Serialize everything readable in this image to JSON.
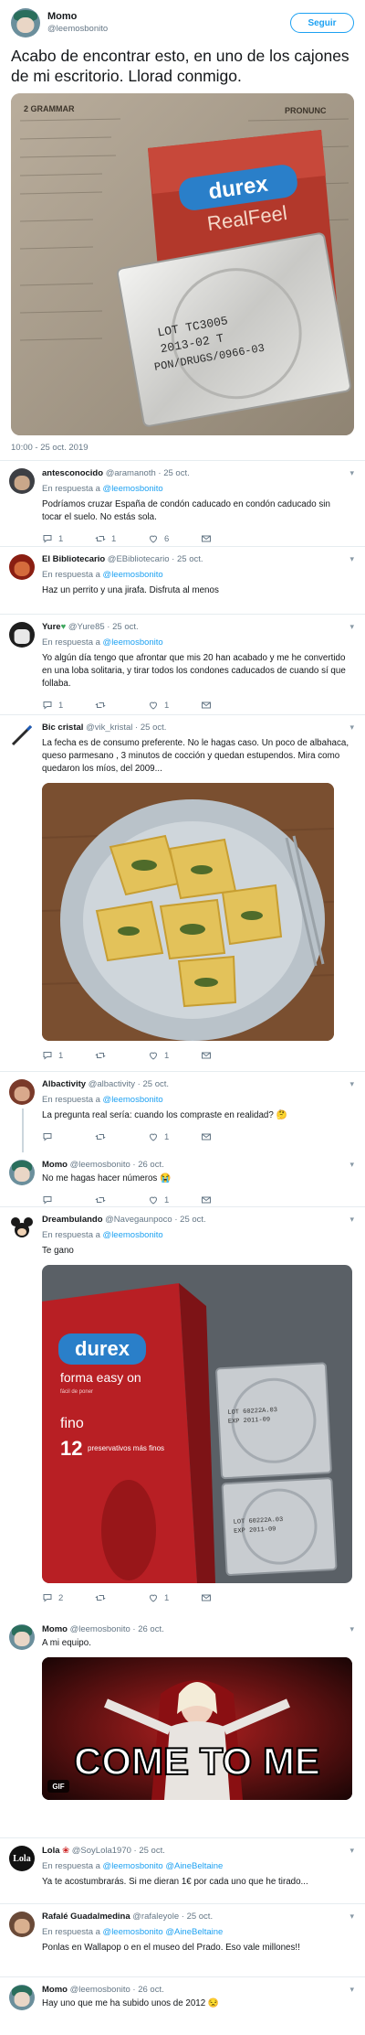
{
  "main_tweet": {
    "display_name": "Momo",
    "handle": "@leemosbonito",
    "follow_label": "Seguir",
    "text": "Acabo de encontrar esto, en uno de los cajones de mi escritorio. Llorad conmigo.",
    "timestamp": "10:00 - 25 oct. 2019",
    "photo_text": {
      "grammar": "2 GRAMMAR",
      "brand": "durex",
      "product": "RealFeel",
      "lot": "LOT TC3005",
      "expiry": "2013-02 T",
      "code": "PON/DRUGS/0966-03",
      "pronunc": "PRONUNC"
    }
  },
  "reply_prefix": "En respuesta a",
  "replies": [
    {
      "name": "antesconocido",
      "handle": "@aramanoth",
      "date": "25 oct.",
      "reply_to": "@leemosbonito",
      "text": "Podríamos cruzar España de condón caducado en condón caducado sin tocar el suelo. No estás sola.",
      "replies": "1",
      "retweets": "1",
      "likes": "6"
    },
    {
      "name": "El Bibliotecario",
      "handle": "@EBibliotecario",
      "date": "25 oct.",
      "reply_to": "@leemosbonito",
      "text": "Haz un perrito y una jirafa. Disfruta al menos",
      "replies": "",
      "retweets": "",
      "likes": ""
    },
    {
      "name": "Yure",
      "handle": "@Yure85",
      "date": "25 oct.",
      "reply_to": "@leemosbonito",
      "text": "Yo algún día tengo que afrontar que mis 20 han acabado y me he convertido en una loba solitaria, y tirar todos los condones caducados de cuando sí que follaba.",
      "replies": "1",
      "retweets": "",
      "likes": "1"
    },
    {
      "name": "Bic cristal",
      "handle": "@vik_kristal",
      "date": "25 oct.",
      "text": "La fecha es de consumo preferente. No le hagas caso. Un poco de albahaca, queso parmesano , 3 minutos de cocción y quedan estupendos. Mira como quedaron los míos, del 2009...",
      "replies": "1",
      "retweets": "",
      "likes": "1"
    },
    {
      "name": "Albactivity",
      "handle": "@albactivity",
      "date": "25 oct.",
      "reply_to": "@leemosbonito",
      "text": "La pregunta real sería: cuando los compraste en realidad? 🤔",
      "replies": "",
      "retweets": "",
      "likes": "1"
    },
    {
      "name": "Momo",
      "handle": "@leemosbonito",
      "date": "26 oct.",
      "text": "No me hagas hacer números 😭",
      "replies": "",
      "retweets": "",
      "likes": "1"
    },
    {
      "name": "Dreambulando",
      "handle": "@Navegaunpoco",
      "date": "25 oct.",
      "reply_to": "@leemosbonito",
      "text": "Te gano",
      "replies": "2",
      "retweets": "",
      "likes": "1",
      "photo_text": {
        "brand": "durex",
        "product": "forma easy on",
        "sub": "fácil de poner",
        "fino": "fino",
        "count": "12",
        "count_label": "preservativos más finos",
        "lot1": "LOT 60222A.03",
        "exp1": "EXP 2011-09",
        "lot2": "LOT 60222A.03",
        "exp2": "EXP 2011-09"
      }
    },
    {
      "name": "Momo",
      "handle": "@leemosbonito",
      "date": "26 oct.",
      "text": "A mi equipo.",
      "replies": "",
      "retweets": "",
      "likes": "1",
      "gif_caption": "COME TO ME",
      "gif_badge": "GIF"
    },
    {
      "name": "Lola",
      "handle": "@SoyLola1970",
      "date": "25 oct.",
      "reply_to": "@leemosbonito @AineBeltaine",
      "text": "Ya te acostumbrarás. Si me dieran 1€ por cada uno que he tirado...",
      "replies": "",
      "retweets": "",
      "likes": "1",
      "avatar_text": "Lola"
    },
    {
      "name": "Rafalé Guadalmedina",
      "handle": "@rafaleyole",
      "date": "25 oct.",
      "reply_to": "@leemosbonito @AineBeltaine",
      "text": "Ponlas en Wallapop o en el museo del Prado. Eso vale millones!!",
      "replies": "",
      "retweets": "",
      "likes": "1"
    },
    {
      "name": "Momo",
      "handle": "@leemosbonito",
      "date": "26 oct.",
      "text": "Hay uno que me ha subido unos de 2012 😒",
      "replies": "",
      "retweets": "",
      "likes": ""
    }
  ],
  "colors": {
    "accent": "#1da1f2",
    "text": "#14171a",
    "muted": "#657786",
    "divider": "#e6ecf0"
  }
}
